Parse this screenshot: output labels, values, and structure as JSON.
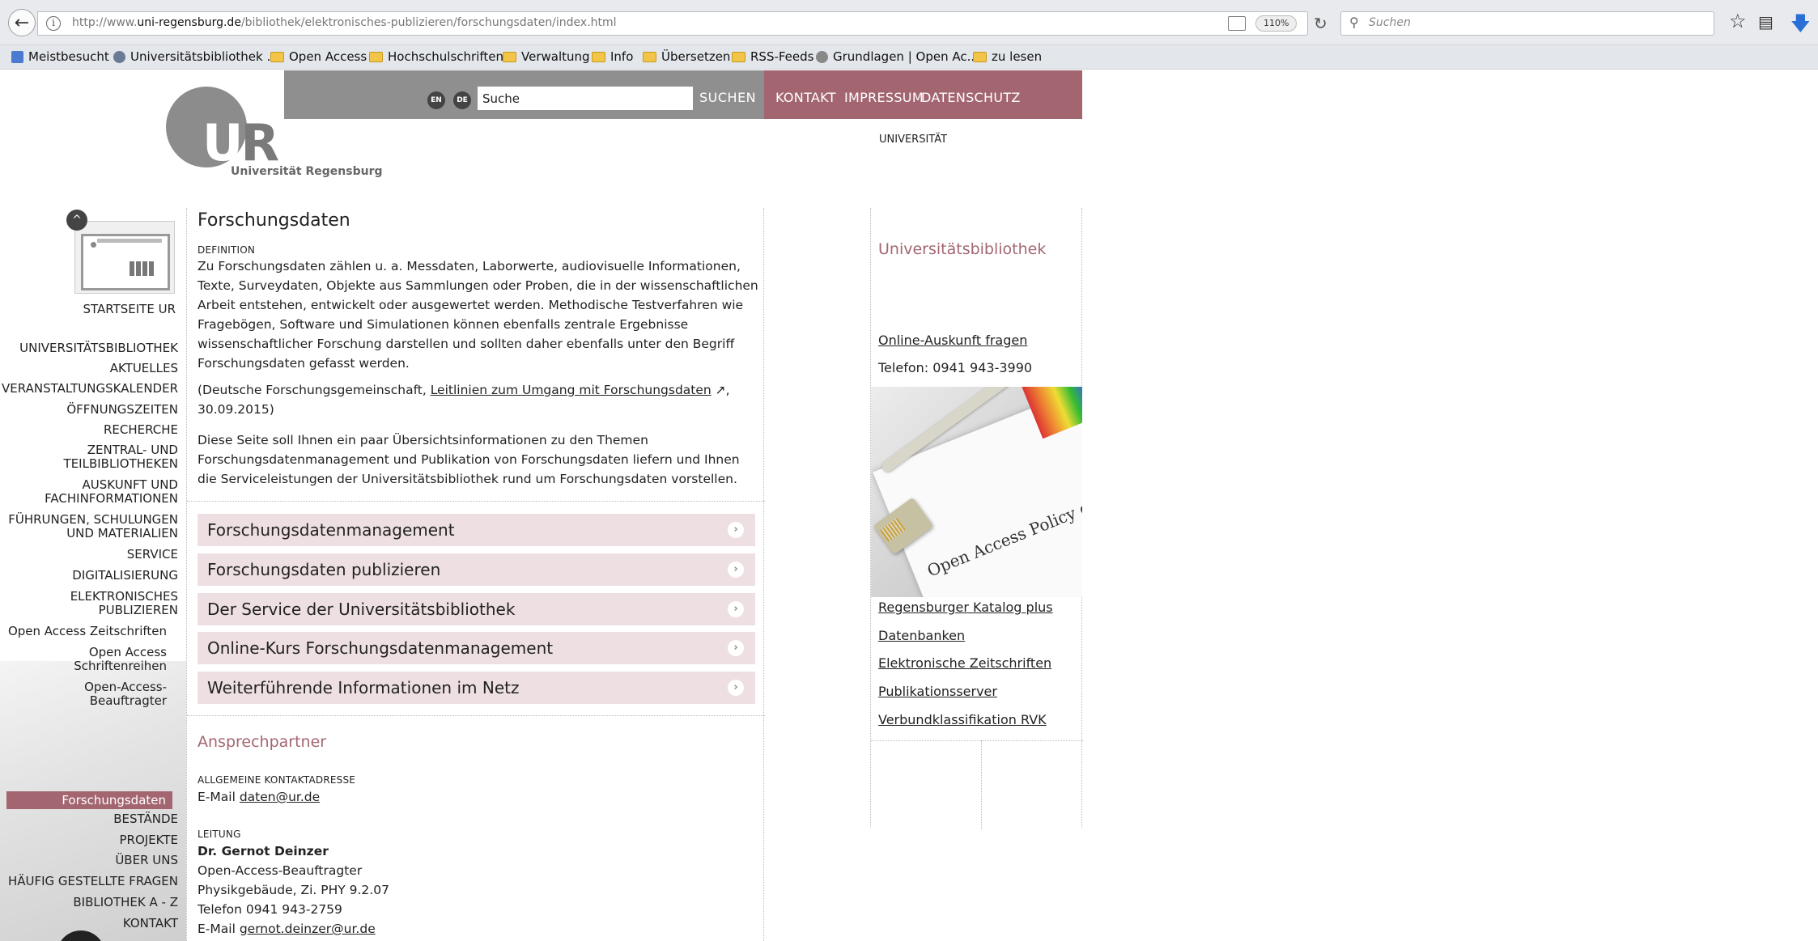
{
  "browser": {
    "url_prefix": "http://www.",
    "url_domain": "uni-regensburg.de",
    "url_path": "/bibliothek/elektronisches-publizieren/forschungsdaten/index.html",
    "zoom": "110%",
    "search_placeholder": "Suchen",
    "bookmarks": [
      {
        "label": "Meistbesucht",
        "icon": "bookmark-star-icon"
      },
      {
        "label": "Universitätsbibliothek ...",
        "icon": "site-icon"
      },
      {
        "label": "Open Access",
        "icon": "folder-icon"
      },
      {
        "label": "Hochschulschriften",
        "icon": "folder-icon"
      },
      {
        "label": "Verwaltung",
        "icon": "folder-icon"
      },
      {
        "label": "Info",
        "icon": "folder-icon"
      },
      {
        "label": "Übersetzen",
        "icon": "folder-icon"
      },
      {
        "label": "RSS-Feeds",
        "icon": "folder-icon"
      },
      {
        "label": "Grundlagen | Open Ac...",
        "icon": "site-icon"
      },
      {
        "label": "zu lesen",
        "icon": "folder-icon"
      }
    ]
  },
  "header": {
    "logo_caption": "Universität Regensburg",
    "lang_en": "EN",
    "lang_de": "DE",
    "search_value": "Suche",
    "search_button": "SUCHEN",
    "links": [
      "KONTAKT",
      "IMPRESSUM",
      "DATENSCHUTZ"
    ],
    "university_label": "UNIVERSITÄT"
  },
  "sidebar": {
    "home_label": "STARTSEITE UR",
    "items": [
      "UNIVERSITÄTSBIBLIOTHEK",
      "AKTUELLES",
      "VERANSTALTUNGSKALENDER",
      "ÖFFNUNGSZEITEN",
      "RECHERCHE",
      "ZENTRAL- UND",
      "TEILBIBLIOTHEKEN",
      "AUSKUNFT UND",
      "FACHINFORMATIONEN",
      "FÜHRUNGEN, SCHULUNGEN",
      "UND MATERIALIEN",
      "SERVICE",
      "DIGITALISIERUNG",
      "ELEKTRONISCHES",
      "PUBLIZIEREN"
    ],
    "sub_items": [
      "Open Access Zeitschriften",
      "Open Access",
      "Schriftenreihen",
      "Open-Access-",
      "Beauftragter"
    ],
    "active_item": "Forschungsdaten",
    "after_items": [
      "BESTÄNDE",
      "PROJEKTE",
      "ÜBER UNS",
      "HÄUFIG GESTELLTE FRAGEN",
      "BIBLIOTHEK A - Z",
      "KONTAKT"
    ]
  },
  "main": {
    "title": "Forschungsdaten",
    "definition_label": "DEFINITION",
    "definition_text": "Zu Forschungsdaten zählen u. a. Messdaten, Laborwerte, audiovisuelle Informationen, Texte, Surveydaten, Objekte aus Sammlungen oder Proben, die in der wissenschaftlichen Arbeit entstehen, entwickelt oder ausgewertet werden. Methodische Testverfahren wie Fragebögen, Software und Simulationen können ebenfalls zentrale Ergebnisse wissenschaftlicher Forschung darstellen und sollten daher ebenfalls unter den Begriff Forschungsdaten gefasst werden.",
    "citation_prefix": "(Deutsche Forschungsgemeinschaft, ",
    "citation_link": "Leitlinien zum Umgang mit Forschungsdaten",
    "citation_suffix": ", 30.09.2015)",
    "intro_text": "Diese Seite soll Ihnen ein paar Übersichtsinformationen zu den Themen Forschungsdatenmanagement und Publikation von Forschungsdaten liefern und Ihnen die Serviceleistungen der Universitätsbibliothek rund um Forschungsdaten vorstellen.",
    "accordions": [
      "Forschungsdatenmanagement",
      "Forschungsdaten publizieren",
      "Der Service der Universitätsbibliothek",
      "Online-Kurs Forschungsdatenmanagement",
      "Weiterführende Informationen im Netz"
    ],
    "contacts_heading": "Ansprechpartner",
    "general_label": "ALLGEMEINE KONTAKTADRESSE",
    "email_prefix": "E-Mail ",
    "general_email": "daten@ur.de",
    "lead_label": "LEITUNG",
    "lead_name": "Dr. Gernot Deinzer",
    "lead_role": "Open-Access-Beauftragter",
    "lead_room": "Physikgebäude, Zi. PHY 9.2.07",
    "lead_phone": "Telefon 0941 943-2759",
    "lead_email": "gernot.deinzer@ur.de"
  },
  "right": {
    "title": "Universitätsbibliothek",
    "online_help": "Online-Auskunft fragen",
    "phone": "Telefon: 0941 943-3990",
    "photo_caption": "Open Access Policy der Univ",
    "links": [
      "Regensburger Katalog plus",
      "Datenbanken",
      "Elektronische Zeitschriften",
      "Publikationsserver",
      "Verbundklassifikation RVK"
    ]
  }
}
